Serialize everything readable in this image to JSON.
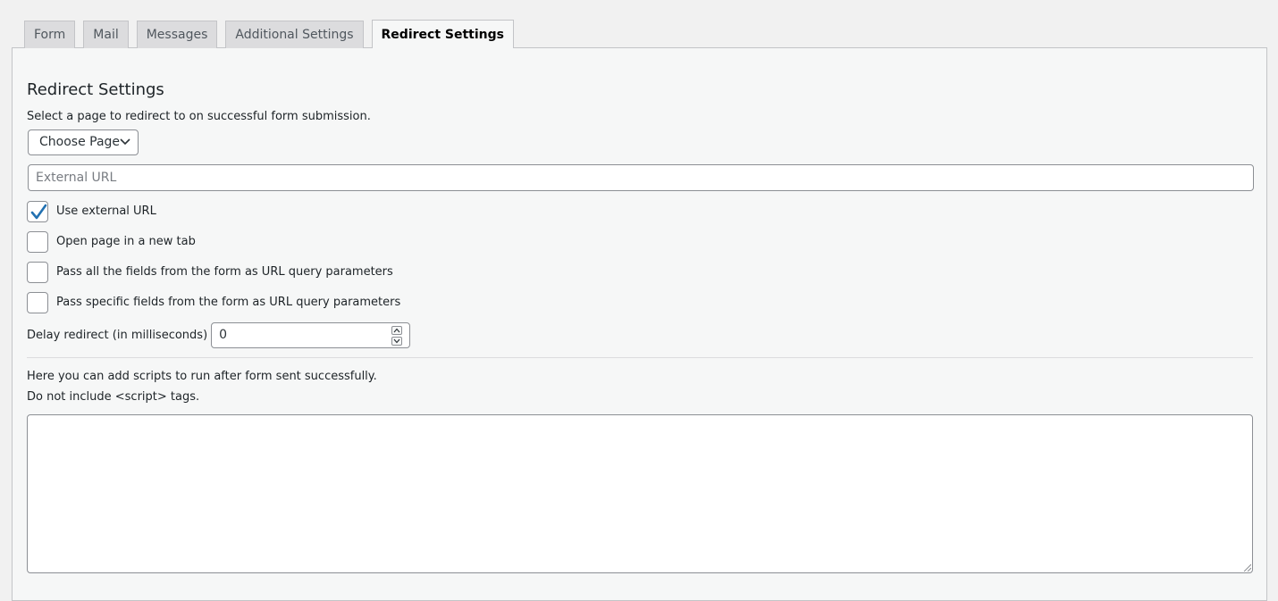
{
  "tabs": [
    {
      "label": "Form",
      "active": false
    },
    {
      "label": "Mail",
      "active": false
    },
    {
      "label": "Messages",
      "active": false
    },
    {
      "label": "Additional Settings",
      "active": false
    },
    {
      "label": "Redirect Settings",
      "active": true
    }
  ],
  "redirect": {
    "title": "Redirect Settings",
    "description": "Select a page to redirect to on successful form submission.",
    "page_select": {
      "selected": "Choose Page"
    },
    "external_url": {
      "value": "",
      "placeholder": "External URL"
    },
    "options": [
      {
        "label": "Use external URL",
        "checked": true
      },
      {
        "label": "Open page in a new tab",
        "checked": false
      },
      {
        "label": "Pass all the fields from the form as URL query parameters",
        "checked": false
      },
      {
        "label": "Pass specific fields from the form as URL query parameters",
        "checked": false
      }
    ],
    "delay": {
      "label": "Delay redirect (in milliseconds)",
      "value": "0"
    }
  },
  "scripts": {
    "line1": "Here you can add scripts to run after form sent successfully.",
    "line2": "Do not include <script> tags.",
    "value": ""
  },
  "colors": {
    "checkmark": "#2271b1",
    "border": "#8c8f94",
    "panel_bg": "#f6f7f7"
  },
  "icons": {
    "select": "chevron-down-icon",
    "checked": "checkmark-icon",
    "spinner_up": "chevron-up-icon",
    "spinner_down": "chevron-down-icon",
    "textarea_resize": "resize-grip-icon"
  }
}
